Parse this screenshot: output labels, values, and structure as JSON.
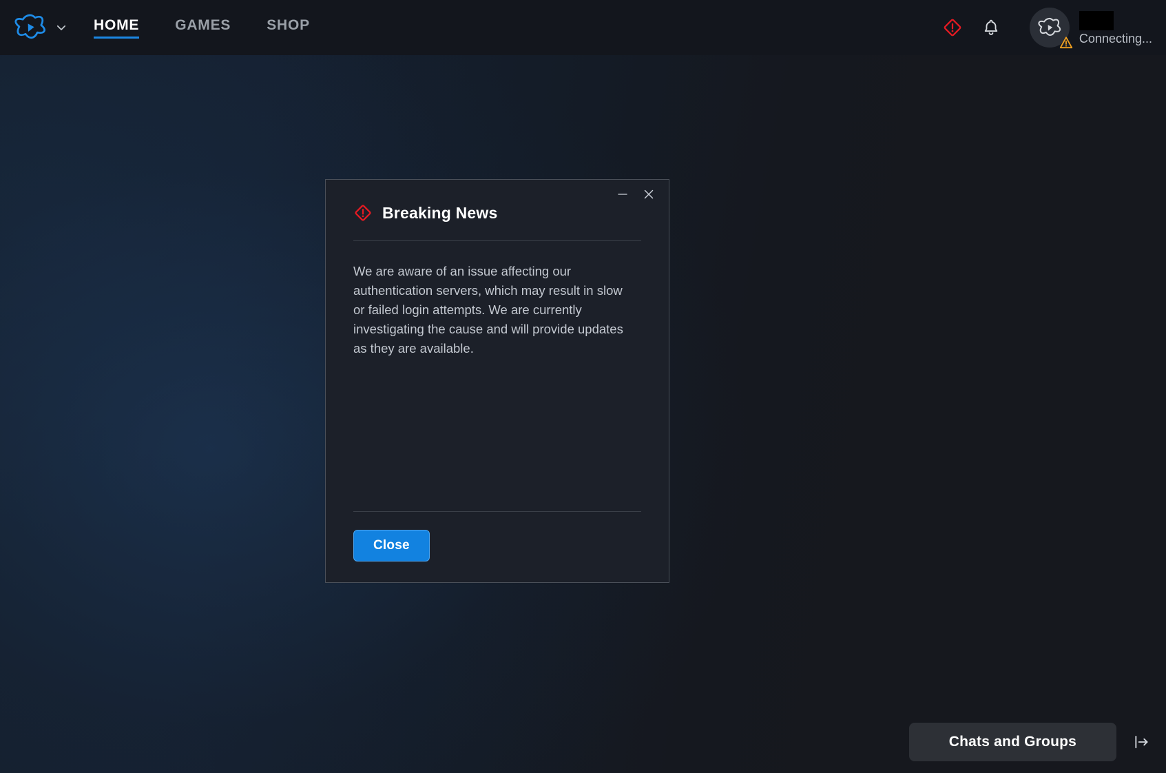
{
  "app": {
    "title": "Battle.net",
    "background_color": "#15202e",
    "accent_color": "#1b87e4"
  },
  "topbar": {
    "brand": {
      "logo_icon": "battlenet-logo-icon",
      "chevron_icon": "chevron-down-icon"
    },
    "nav": [
      {
        "label": "HOME",
        "active": true
      },
      {
        "label": "GAMES",
        "active": false
      },
      {
        "label": "SHOP",
        "active": false
      }
    ],
    "actions": [
      {
        "icon": "alert-diamond-icon",
        "color": "#e51a22"
      },
      {
        "icon": "bell-icon",
        "color": "#d7dadf"
      }
    ],
    "account": {
      "avatar_icon": "battlenet-avatar-icon",
      "badge_icon": "warning-triangle-icon",
      "badge_color": "#f0a020",
      "username_redacted": true,
      "status": "Connecting..."
    }
  },
  "modal": {
    "icon": "alert-diamond-icon",
    "icon_color": "#e51a22",
    "title": "Breaking News",
    "body": "We are aware of an issue affecting our authentication servers, which may result in slow or failed login attempts. We are currently investigating the cause and will provide updates as they are available.",
    "window_controls": {
      "minimize_icon": "minimize-icon",
      "close_icon": "close-icon"
    },
    "primary_button": {
      "label": "Close",
      "color": "#1282e0"
    }
  },
  "chatbar": {
    "label": "Chats and Groups",
    "expand_icon": "panel-expand-icon"
  }
}
